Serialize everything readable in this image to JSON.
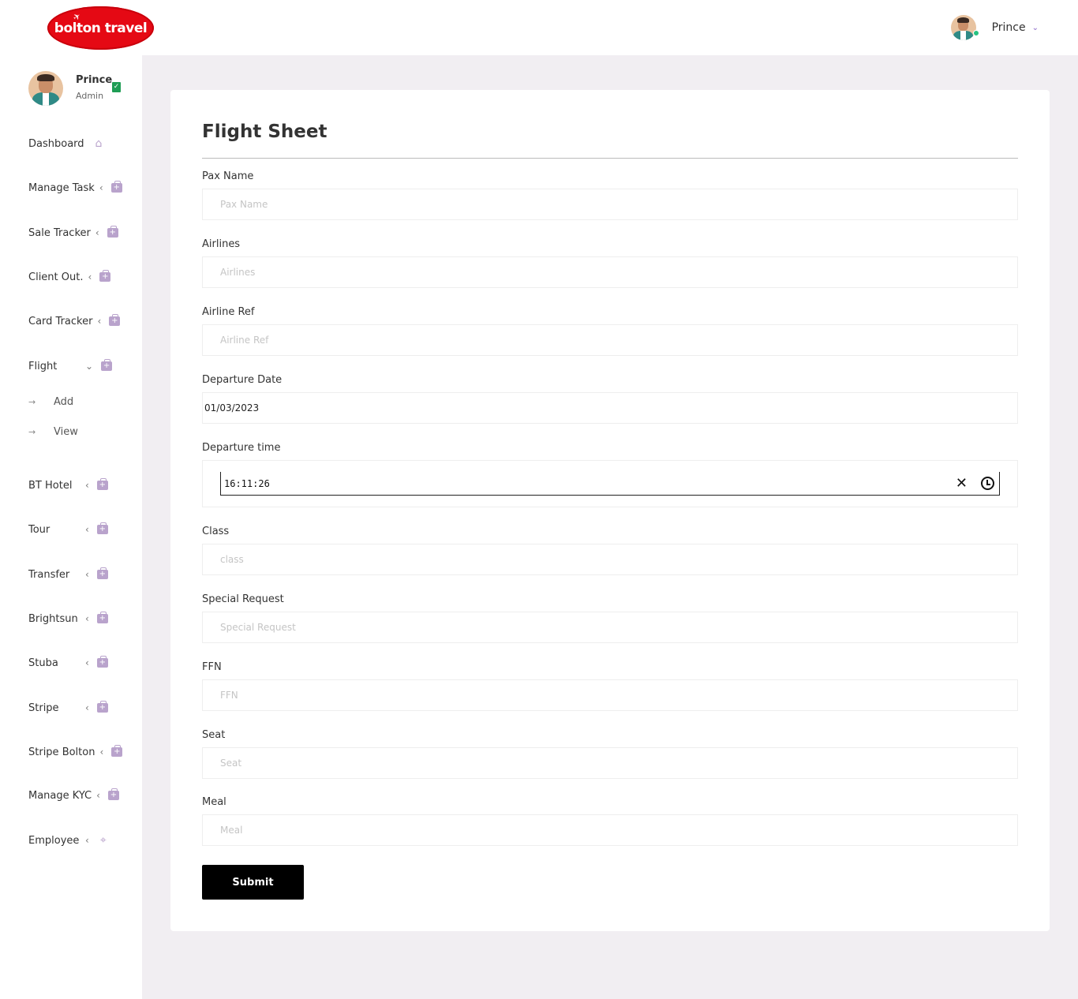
{
  "header": {
    "logo_text": "bolton travel",
    "user_name": "Prince"
  },
  "sidebar": {
    "profile": {
      "name": "Prince",
      "role": "Admin"
    },
    "items": [
      {
        "label": "Dashboard",
        "icon": "home-icon"
      },
      {
        "label": "Manage Task",
        "icon": "medkit-icon"
      },
      {
        "label": "Sale Tracker",
        "icon": "medkit-icon"
      },
      {
        "label": "Client Out.",
        "icon": "medkit-icon"
      },
      {
        "label": "Card Tracker",
        "icon": "medkit-icon"
      },
      {
        "label": "Flight",
        "icon": "medkit-icon",
        "expanded": true,
        "children": [
          "Add",
          "View"
        ]
      },
      {
        "label": "BT Hotel",
        "icon": "medkit-icon"
      },
      {
        "label": "Tour",
        "icon": "medkit-icon"
      },
      {
        "label": "Transfer",
        "icon": "medkit-icon"
      },
      {
        "label": "Brightsun",
        "icon": "medkit-icon"
      },
      {
        "label": "Stuba",
        "icon": "medkit-icon"
      },
      {
        "label": "Stripe",
        "icon": "medkit-icon"
      },
      {
        "label": "Stripe Bolton",
        "icon": "medkit-icon"
      },
      {
        "label": "Manage KYC",
        "icon": "medkit-icon"
      },
      {
        "label": "Employee",
        "icon": "target-icon"
      }
    ]
  },
  "form": {
    "title": "Flight Sheet",
    "fields": [
      {
        "label": "Pax Name",
        "placeholder": "Pax Name",
        "value": ""
      },
      {
        "label": "Airlines",
        "placeholder": "Airlines",
        "value": ""
      },
      {
        "label": "Airline Ref",
        "placeholder": "Airline Ref",
        "value": ""
      },
      {
        "label": "Departure Date",
        "placeholder": "",
        "value": "01/03/2023"
      },
      {
        "label": "Departure time",
        "placeholder": "",
        "value": "16:11:26"
      },
      {
        "label": "Class",
        "placeholder": "class",
        "value": ""
      },
      {
        "label": "Special Request",
        "placeholder": "Special Request",
        "value": ""
      },
      {
        "label": "FFN",
        "placeholder": "FFN",
        "value": ""
      },
      {
        "label": "Seat",
        "placeholder": "Seat",
        "value": ""
      },
      {
        "label": "Meal",
        "placeholder": "Meal",
        "value": ""
      }
    ],
    "submit_label": "Submit"
  },
  "colors": {
    "brand_red": "#e50914",
    "icon_purple": "#b9a3cc",
    "main_bg": "#f1eef2",
    "online_green": "#26c281",
    "verified_green": "#1f9d55"
  }
}
